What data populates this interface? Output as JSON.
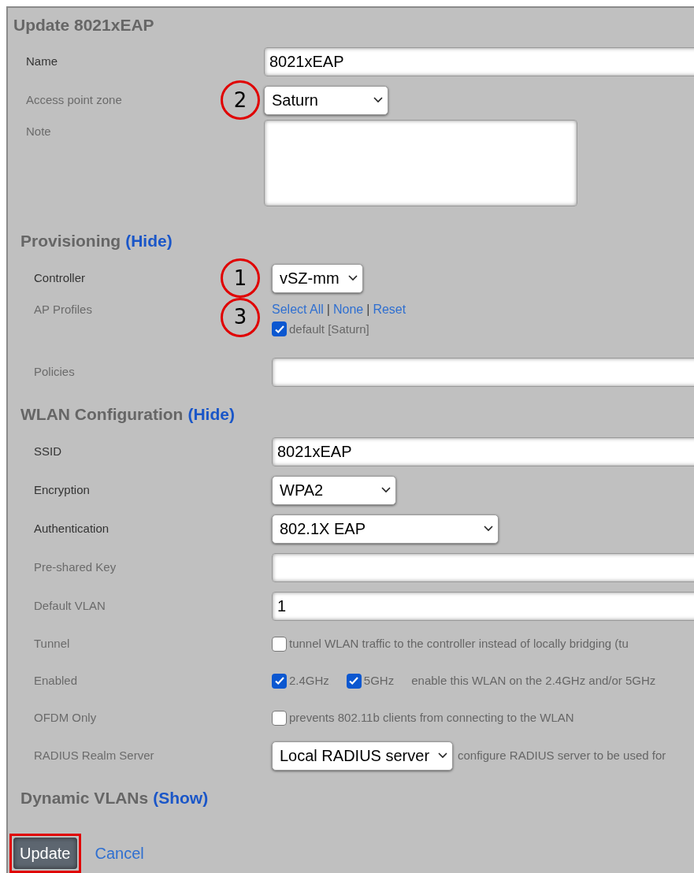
{
  "title": "Update 8021xEAP",
  "fields": [
    {
      "kind": "text",
      "label": "Name",
      "required": true,
      "value": "8021xEAP"
    },
    {
      "kind": "select",
      "label": "Access point zone",
      "required": false,
      "value": "Saturn",
      "callout": "2"
    },
    {
      "kind": "textarea",
      "label": "Note",
      "required": false
    }
  ],
  "sections": [
    {
      "title": "Provisioning",
      "toggle": "(Hide)",
      "rows": [
        {
          "kind": "select",
          "label": "Controller",
          "required": true,
          "value": "vSZ-mm",
          "callout": "1"
        },
        {
          "kind": "profiles",
          "label": "AP Profiles",
          "required": false,
          "callout": "3",
          "links": [
            "Select All",
            "None",
            "Reset"
          ],
          "separators": [
            "|",
            "|"
          ],
          "options": [
            {
              "label": "default [Saturn]",
              "checked": true
            }
          ]
        },
        {
          "kind": "text",
          "label": "Policies",
          "required": false,
          "value": ""
        }
      ]
    },
    {
      "title": "WLAN Configuration",
      "toggle": "(Hide)",
      "rows": [
        {
          "kind": "text",
          "label": "SSID",
          "required": true,
          "value": "8021xEAP"
        },
        {
          "kind": "select",
          "label": "Encryption",
          "required": true,
          "value": "WPA2"
        },
        {
          "kind": "select",
          "label": "Authentication",
          "required": true,
          "value": "802.1X EAP"
        },
        {
          "kind": "text",
          "label": "Pre-shared Key",
          "required": false,
          "value": ""
        },
        {
          "kind": "text",
          "label": "Default VLAN",
          "required": false,
          "value": "1"
        },
        {
          "kind": "checks",
          "label": "Tunnel",
          "required": false,
          "options": [
            {
              "label": "tunnel WLAN traffic to the controller instead of locally bridging (tu",
              "checked": false
            }
          ]
        },
        {
          "kind": "checks",
          "label": "Enabled",
          "required": false,
          "options": [
            {
              "label": "2.4GHz",
              "checked": true
            },
            {
              "label": "5GHz",
              "checked": true
            }
          ],
          "hint": "enable this WLAN on the 2.4GHz and/or 5GHz"
        },
        {
          "kind": "checks",
          "label": "OFDM Only",
          "required": false,
          "options": [
            {
              "label": "prevents 802.11b clients from connecting to the WLAN",
              "checked": false
            }
          ]
        },
        {
          "kind": "select",
          "label": "RADIUS Realm Server",
          "required": false,
          "value": "Local RADIUS server",
          "hint": "configure RADIUS server to be used for"
        }
      ]
    },
    {
      "title": "Dynamic VLANs",
      "toggle": "(Show)"
    }
  ],
  "buttons": {
    "submit": "Update",
    "cancel": "Cancel"
  }
}
